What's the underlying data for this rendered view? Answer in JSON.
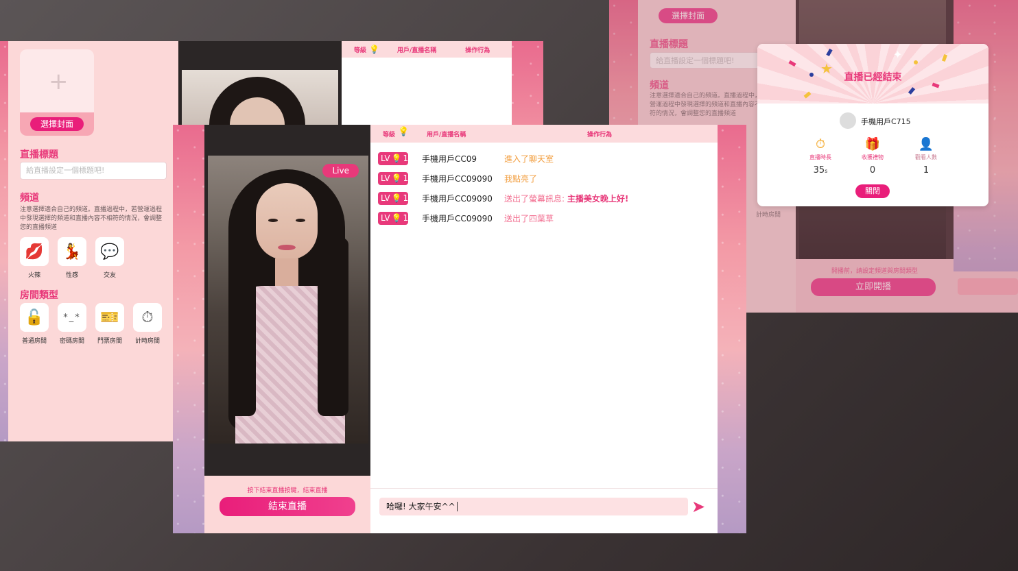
{
  "left_window": {
    "choose_cover": "選擇封面",
    "stream_title_heading": "直播標題",
    "stream_title_placeholder": "給直播設定一個標題吧!",
    "channel_heading": "頻道",
    "channel_note": "注意選擇適合自己的頻道。直播過程中，若營運過程中發現選擇的頻道和直播內容不相符的情況，會調整您的直播頻道",
    "channels": [
      {
        "label": "火辣",
        "icon": "lips-icon"
      },
      {
        "label": "性感",
        "icon": "dancer-icon"
      },
      {
        "label": "交友",
        "icon": "heart-chat-icon"
      }
    ],
    "room_type_heading": "房間類型",
    "room_types": [
      {
        "label": "普通房間",
        "icon": "unlock-icon"
      },
      {
        "label": "密碼房間",
        "icon": "password-icon"
      },
      {
        "label": "門票房間",
        "icon": "ticket-icon"
      },
      {
        "label": "計時房間",
        "icon": "timer-icon"
      }
    ],
    "chat_header": {
      "level": "等級",
      "user": "用戶/直播名稱",
      "action": "操作行為"
    }
  },
  "right_window": {
    "choose_cover": "選擇封面",
    "stream_title_heading": "直播標題",
    "stream_title_placeholder": "給直播設定一個標題吧!",
    "channel_heading": "頻道",
    "channel_note": "注意選擇適合自己的頻道。直播過程中，若營運過程中發現選擇的頻道和直播內容不相符的情況，會調整您的直播頻道",
    "timer_room": "計時房間",
    "hint": "開播前，請設定頻道與房間類型",
    "start_button": "立即開播"
  },
  "main_window": {
    "live_badge": "Live",
    "end_hint": "按下結束直播按鍵，結束直播",
    "end_button": "結束直播",
    "chat_header": {
      "level": "等級",
      "user": "用戶/直播名稱",
      "action": "操作行為"
    },
    "messages": [
      {
        "lv": "LV",
        "level": "1",
        "user": "手機用戶CC09",
        "action": "進入了聊天室",
        "highlight": "",
        "style": "orange"
      },
      {
        "lv": "LV",
        "level": "1",
        "user": "手機用戶CC09090",
        "action": "我點亮了",
        "highlight": "",
        "style": "orange"
      },
      {
        "lv": "LV",
        "level": "1",
        "user": "手機用戶CC09090",
        "action": "送出了螢幕訊息: ",
        "highlight": "主播美女晚上好!",
        "style": "pink"
      },
      {
        "lv": "LV",
        "level": "1",
        "user": "手機用戶CC09090",
        "action": "送出了四葉草",
        "highlight": "",
        "style": "pink"
      }
    ],
    "input_value": "哈囉! 大家午安^^"
  },
  "modal": {
    "title": "直播已經結束",
    "username": "手機用戶C715",
    "stats": [
      {
        "label": "直播時長",
        "value": "35",
        "unit": "s",
        "icon": "stopwatch-icon"
      },
      {
        "label": "收獲禮物",
        "value": "0",
        "unit": "",
        "icon": "gift-icon"
      },
      {
        "label": "觀看人數",
        "value": "1",
        "unit": "",
        "icon": "user-icon"
      }
    ],
    "close_button": "關閉"
  },
  "colors": {
    "accent": "#e8397a",
    "panel_bg": "#fcd8d8",
    "header_bg": "#fcdbdd",
    "action_orange": "#f29c3b"
  }
}
